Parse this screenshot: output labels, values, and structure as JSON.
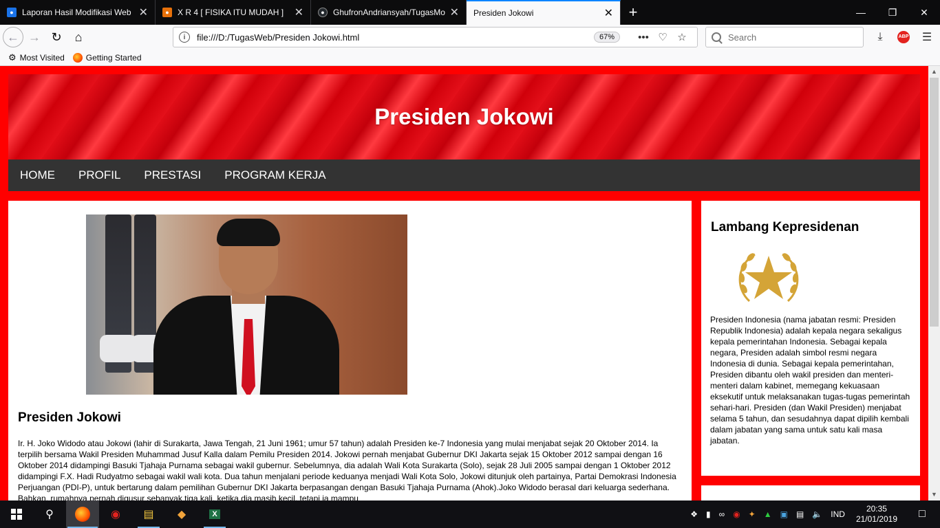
{
  "browser": {
    "tabs": [
      {
        "title": "Laporan Hasil Modifikasi Web",
        "favicon_color": "#1a73e8"
      },
      {
        "title": "X R 4 [ FISIKA ITU MUDAH ]",
        "favicon_color": "#e8710a"
      },
      {
        "title": "GhufronAndriansyah/TugasMo",
        "favicon_color": "#24292e"
      },
      {
        "title": "Presiden Jokowi",
        "favicon_color": "#f9f9fa",
        "active": true
      }
    ],
    "url": "file:///D:/TugasWeb/Presiden Jokowi.html",
    "zoom": "67%",
    "search_placeholder": "Search",
    "bookmarks": [
      {
        "label": "Most Visited",
        "icon": "gear-icon"
      },
      {
        "label": "Getting Started",
        "icon": "firefox-icon"
      }
    ],
    "abp_label": "ABP"
  },
  "page": {
    "header_title": "Presiden Jokowi",
    "menu": [
      "HOME",
      "PROFIL",
      "PRESTASI",
      "PROGRAM KERJA"
    ],
    "article_title": "Presiden Jokowi",
    "article_text": "Ir. H. Joko Widodo atau Jokowi (lahir di Surakarta, Jawa Tengah, 21 Juni 1961; umur 57 tahun) adalah Presiden ke-7 Indonesia yang mulai menjabat sejak 20 Oktober 2014. Ia terpilih bersama Wakil Presiden Muhammad Jusuf Kalla dalam Pemilu Presiden 2014. Jokowi pernah menjabat Gubernur DKI Jakarta sejak 15 Oktober 2012 sampai dengan 16 Oktober 2014 didampingi Basuki Tjahaja Purnama sebagai wakil gubernur. Sebelumnya, dia adalah Wali Kota Surakarta (Solo), sejak 28 Juli 2005 sampai dengan 1 Oktober 2012 didampingi F.X. Hadi Rudyatmo sebagai wakil wali kota. Dua tahun menjalani periode keduanya menjadi Wali Kota Solo, Jokowi ditunjuk oleh partainya, Partai Demokrasi Indonesia Perjuangan (PDI-P), untuk bertarung dalam pemilihan Gubernur DKI Jakarta berpasangan dengan Basuki Tjahaja Purnama (Ahok).Joko Widodo berasal dari keluarga sederhana. Bahkan, rumahnya pernah digusur sebanyak tiga kali, ketika dia masih kecil, tetapi ia mampu",
    "sidebar_title": "Lambang Kepresidenan",
    "sidebar_text": "Presiden Indonesia (nama jabatan resmi: Presiden Republik Indonesia) adalah kepala negara sekaligus kepala pemerintahan Indonesia. Sebagai kepala negara, Presiden adalah simbol resmi negara Indonesia di dunia. Sebagai kepala pemerintahan, Presiden dibantu oleh wakil presiden dan menteri-menteri dalam kabinet, memegang kekuasaan eksekutif untuk melaksanakan tugas-tugas pemerintah sehari-hari. Presiden (dan Wakil Presiden) menjabat selama 5 tahun, dan sesudahnya dapat dipilih kembali dalam jabatan yang sama untuk satu kali masa jabatan.",
    "colors": {
      "background": "#ff0000",
      "menu": "#333333",
      "emblem_gold": "#d4a437"
    }
  },
  "taskbar": {
    "language": "IND",
    "time": "20:35",
    "date": "21/01/2019"
  }
}
